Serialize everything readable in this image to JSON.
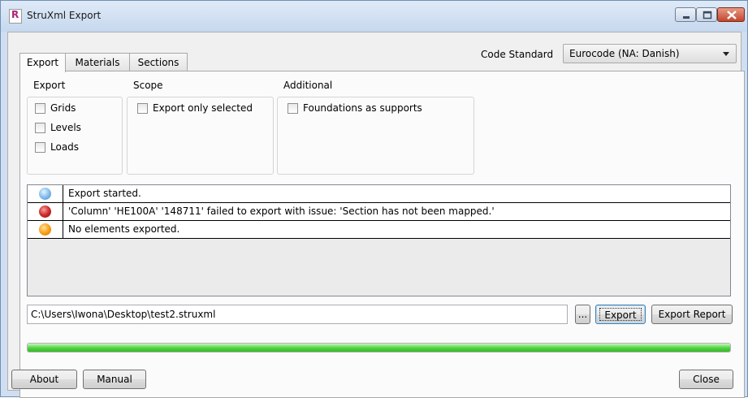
{
  "window": {
    "title": "StruXml Export",
    "app_icon_letter": "R"
  },
  "tabs": [
    {
      "label": "Export",
      "active": true
    },
    {
      "label": "Materials",
      "active": false
    },
    {
      "label": "Sections",
      "active": false
    }
  ],
  "code_standard": {
    "label": "Code Standard",
    "value": "Eurocode (NA: Danish)"
  },
  "groups": {
    "export": {
      "title": "Export",
      "options": [
        {
          "label": "Grids",
          "checked": false
        },
        {
          "label": "Levels",
          "checked": false
        },
        {
          "label": "Loads",
          "checked": false
        }
      ]
    },
    "scope": {
      "title": "Scope",
      "options": [
        {
          "label": "Export only selected",
          "checked": false
        }
      ]
    },
    "additional": {
      "title": "Additional",
      "options": [
        {
          "label": "Foundations as supports",
          "checked": false
        }
      ]
    }
  },
  "log": [
    {
      "level": "info",
      "icon": "info-circle-icon",
      "message": "Export started."
    },
    {
      "level": "error",
      "icon": "error-circle-icon",
      "message": "'Column' 'HE100A' '148711' failed to export with issue: 'Section has not been mapped.'"
    },
    {
      "level": "warning",
      "icon": "warning-circle-icon",
      "message": "No elements exported."
    }
  ],
  "file_path": "C:\\Users\\Iwona\\Desktop\\test2.struxml",
  "buttons": {
    "browse": "...",
    "export": "Export",
    "export_report": "Export Report",
    "about": "About",
    "manual": "Manual",
    "close": "Close"
  },
  "progress": {
    "value": 1.0
  },
  "colors": {
    "progress_fill": "#4fd23f",
    "error": "#d02a2a",
    "warning": "#f7a218",
    "info": "#3f86cf"
  }
}
